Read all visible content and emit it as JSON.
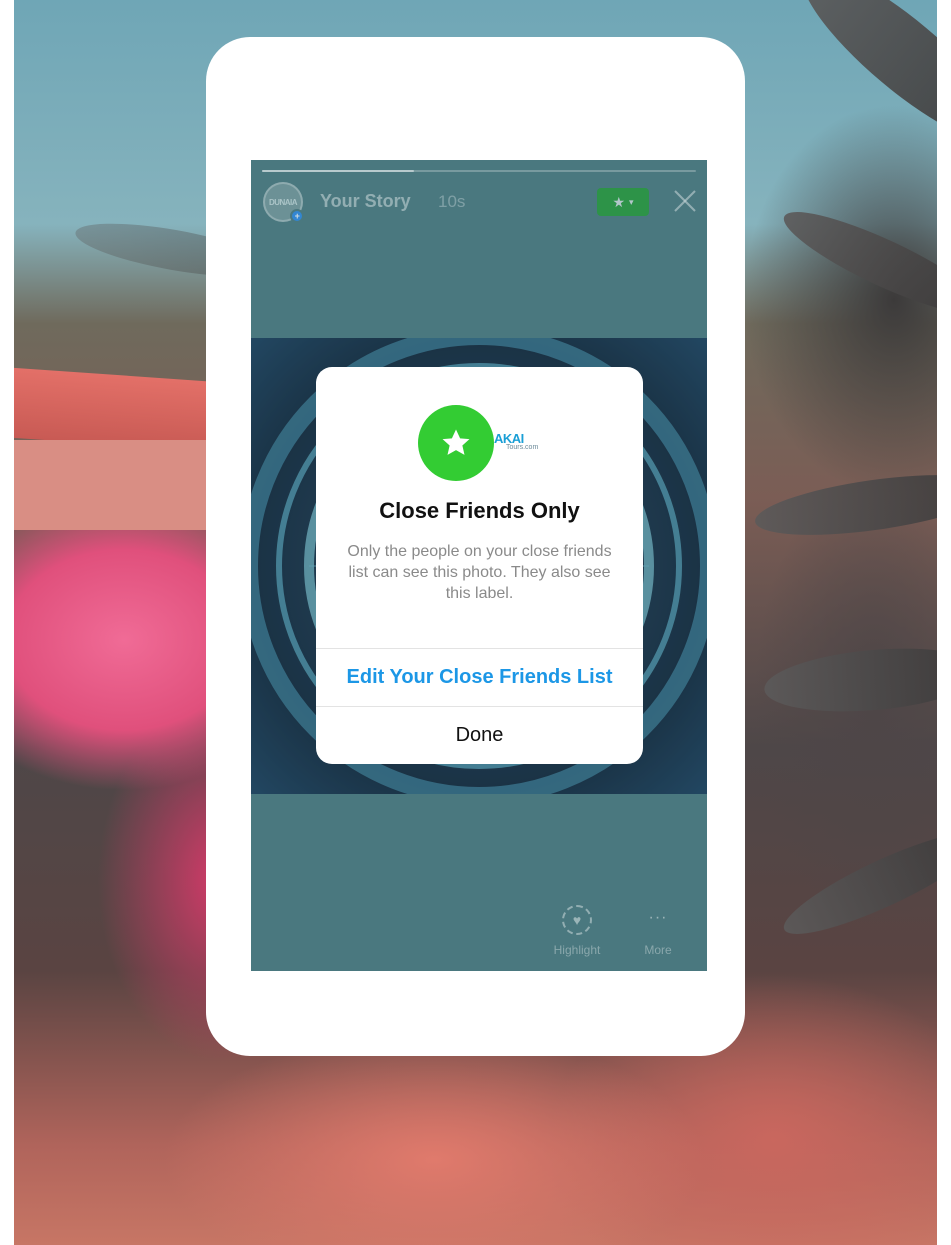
{
  "story": {
    "user_name": "Your Story",
    "elapsed": "10s",
    "avatar_text": "DUNAIA",
    "progress_fraction": 0.35,
    "close_friends_badge_icon": "star-icon",
    "close_icon": "close-icon"
  },
  "dialog": {
    "icon": "star-icon",
    "brand_text_top": "AKAI",
    "brand_text_bottom": "Tours.com",
    "title": "Close Friends Only",
    "body": "Only the people on your close friends list can see this photo. They also see this label.",
    "primary_button": "Edit Your Close Friends List",
    "secondary_button": "Done"
  },
  "actions": [
    {
      "label": "Highlight",
      "icon": "heart-circle-icon"
    },
    {
      "label": "More",
      "icon": "more-icon"
    }
  ],
  "colors": {
    "accent_green": "#33cc33",
    "badge_green": "#1fa827",
    "link_blue": "#1c97e6",
    "story_bg": "#4f7b82"
  }
}
